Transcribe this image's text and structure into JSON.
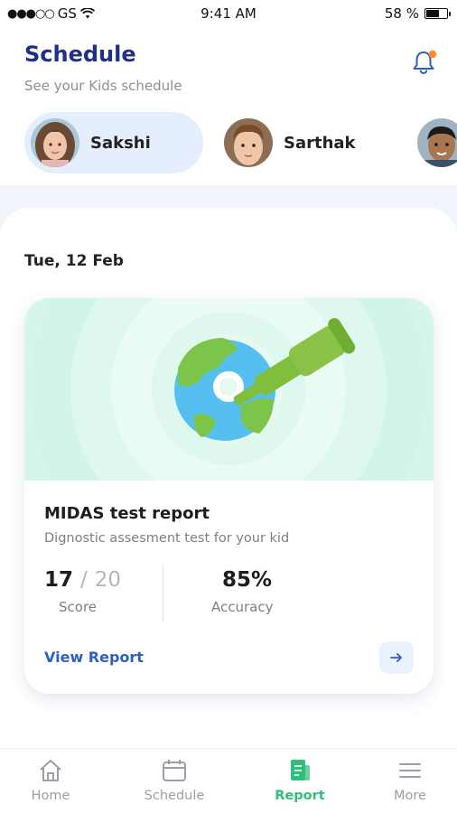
{
  "status_bar": {
    "signal_dots": "●●●○○",
    "carrier": "GS",
    "time": "9:41 AM",
    "battery": "58 %",
    "battery_level": 0.58
  },
  "header": {
    "title": "Schedule",
    "subtitle": "See your Kids schedule",
    "bell_icon": "bell-icon",
    "notification_dot_color": "#ff8a1f"
  },
  "kids": [
    {
      "name": "Sakshi",
      "selected": true
    },
    {
      "name": "Sarthak",
      "selected": false
    },
    {
      "name": "",
      "selected": false
    }
  ],
  "date": "Tue, 12 Feb",
  "card": {
    "title": "MIDAS test report",
    "description": "Dignostic assesment test for your kid",
    "score_value": "17",
    "score_sep": "/",
    "score_total": "20",
    "score_label": "Score",
    "accuracy_value": "85%",
    "accuracy_label": "Accuracy",
    "action_label": "View Report",
    "arrow_icon": "arrow-right-icon"
  },
  "bottom_nav": [
    {
      "label": "Home",
      "icon": "home-icon",
      "active": false
    },
    {
      "label": "Schedule",
      "icon": "calendar-icon",
      "active": false
    },
    {
      "label": "Report",
      "icon": "report-icon",
      "active": true
    },
    {
      "label": "More",
      "icon": "menu-icon",
      "active": false
    }
  ],
  "colors": {
    "primary": "#1f2f8a",
    "link": "#2e5fc7",
    "active_nav": "#2fbf7a",
    "hero_bg": "#d7f6ea"
  }
}
